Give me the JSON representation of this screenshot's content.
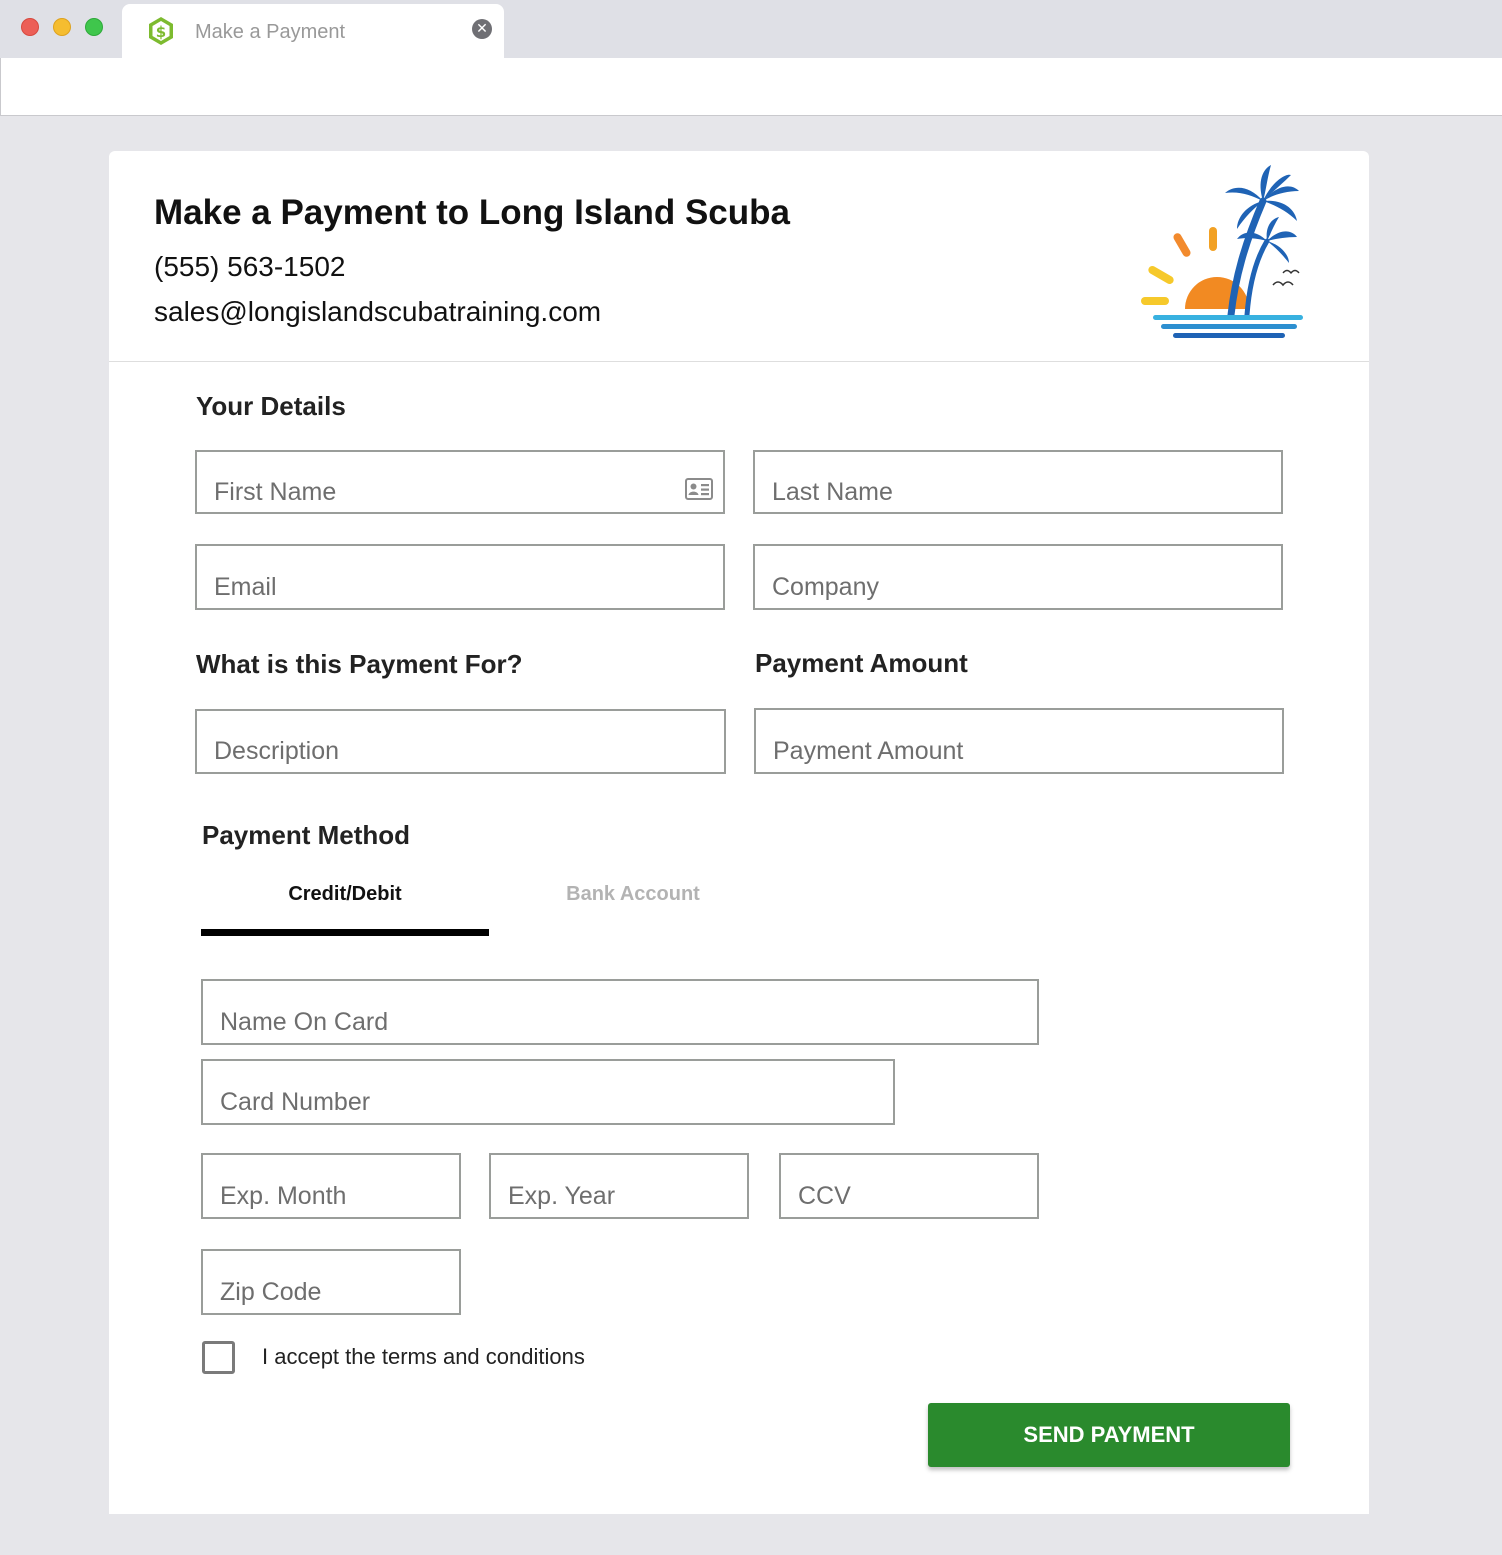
{
  "browser": {
    "tab_title": "Make a Payment",
    "close_symbol": "✕"
  },
  "header": {
    "title": "Make a Payment to Long Island Scuba",
    "phone": "(555) 563-1502",
    "email": "sales@longislandscubatraining.com"
  },
  "details": {
    "title": "Your Details",
    "first_name_placeholder": "First Name",
    "last_name_placeholder": "Last Name",
    "email_placeholder": "Email",
    "company_placeholder": "Company"
  },
  "payment_for": {
    "title": "What is this Payment For?",
    "description_placeholder": "Description"
  },
  "payment_amount": {
    "title": "Payment Amount",
    "amount_placeholder": "Payment Amount"
  },
  "payment_method": {
    "title": "Payment Method",
    "tabs": [
      "Credit/Debit",
      "Bank Account"
    ],
    "active_tab": "Credit/Debit",
    "name_on_card_placeholder": "Name On Card",
    "card_number_placeholder": "Card Number",
    "exp_month_placeholder": "Exp. Month",
    "exp_year_placeholder": "Exp. Year",
    "ccv_placeholder": "CCV",
    "zip_placeholder": "Zip Code"
  },
  "terms": {
    "label": "I accept the terms and conditions",
    "checked": false
  },
  "submit": {
    "label": "SEND PAYMENT"
  },
  "colors": {
    "accent": "#2a8a2d",
    "tab_active": "#000000",
    "tab_inactive": "#b3b3b3",
    "field_border": "#9a9d9a"
  },
  "icons": {
    "tab_favicon": "dollar-hexagon-icon",
    "tab_close": "close-icon",
    "contact_card": "contact-card-icon",
    "logo": "palm-tree-sunset-logo"
  }
}
